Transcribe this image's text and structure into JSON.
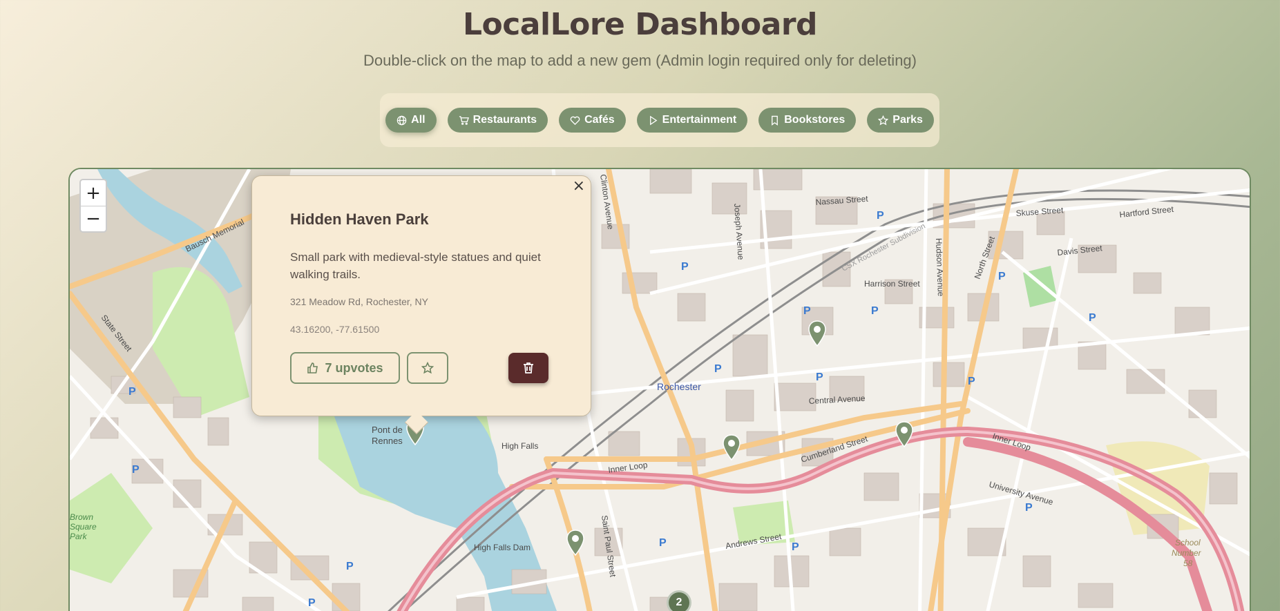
{
  "header": {
    "title": "LocalLore Dashboard",
    "subtitle": "Double-click on the map to add a new gem (Admin login required only for deleting)"
  },
  "filters": [
    {
      "label": "All",
      "icon": "globe-icon",
      "active": true
    },
    {
      "label": "Restaurants",
      "icon": "cart-icon"
    },
    {
      "label": "Cafés",
      "icon": "heart-icon"
    },
    {
      "label": "Entertainment",
      "icon": "play-icon"
    },
    {
      "label": "Bookstores",
      "icon": "bookmark-icon"
    },
    {
      "label": "Parks",
      "icon": "star-icon"
    }
  ],
  "map": {
    "zoom_in": "+",
    "zoom_out": "−",
    "cluster_count": "2",
    "labels": {
      "rochester": "Rochester",
      "high_falls": "High Falls",
      "high_falls_dam": "High Falls Dam",
      "pont": "Pont de",
      "rennes": "Rennes",
      "inner_loop": "Inner Loop",
      "cumberland": "Cumberland Street",
      "central": "Central Avenue",
      "state": "State Street",
      "st_paul": "Saint Paul Street",
      "north_st": "North Street",
      "joseph": "Joseph Avenue",
      "hudson": "Hudson Avenue",
      "clinton": "Clinton Avenue",
      "nassau": "Nassau Street",
      "harrison": "Harrison Street",
      "skuse": "Skuse Street",
      "hartford": "Hartford Street",
      "davis": "Davis Street",
      "csx": "CSX Rochester Subdivision",
      "andrews": "Andrews Street",
      "univ": "University Avenue",
      "bausch": "Bausch Memorial",
      "school": "School",
      "number": "Number",
      "fifty_eight": "58",
      "brown_square": "Brown",
      "square": "Square",
      "park": "Park"
    }
  },
  "popup": {
    "close": "×",
    "title": "Hidden Haven Park",
    "description": "Small park with medieval-style statues and quiet walking trails.",
    "address": "321 Meadow Rd, Rochester, NY",
    "coords": "43.16200, -77.61500",
    "upvotes": "7 upvotes"
  },
  "colors": {
    "accent": "#7c9270",
    "delete": "#5a2b2b",
    "highway": "#e8a0a8",
    "major_road": "#f6c98a"
  }
}
